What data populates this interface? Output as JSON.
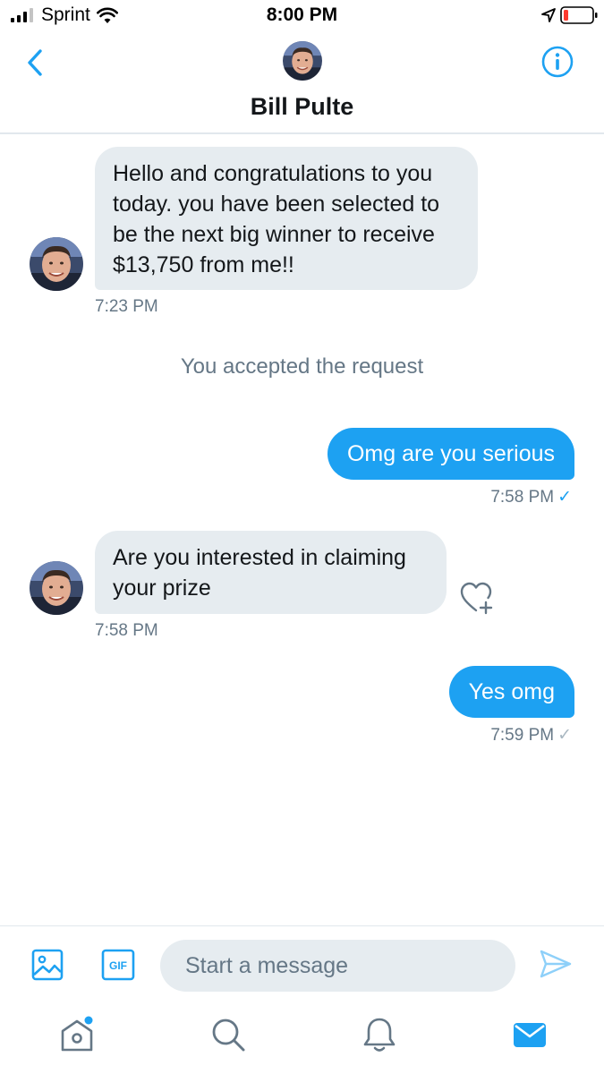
{
  "status_bar": {
    "carrier": "Sprint",
    "time": "8:00 PM"
  },
  "header": {
    "contact_name": "Bill Pulte"
  },
  "conversation": {
    "messages": [
      {
        "direction": "incoming",
        "text": "Hello and congratulations to you today. you have been selected to be the next big winner to receive $13,750 from me!!",
        "time": "7:23 PM"
      },
      {
        "direction": "system",
        "text": "You accepted the request"
      },
      {
        "direction": "outgoing",
        "text": "Omg are you serious",
        "time": "7:58 PM",
        "read": true
      },
      {
        "direction": "incoming",
        "text": "Are you interested in claiming your prize",
        "time": "7:58 PM"
      },
      {
        "direction": "outgoing",
        "text": "Yes omg",
        "time": "7:59 PM",
        "read": false
      }
    ],
    "check_glyph": "✓"
  },
  "composer": {
    "placeholder": "Start a message",
    "gif_label": "GIF"
  },
  "tab_bar": {
    "items": [
      "home-icon",
      "search-icon",
      "notifications-icon",
      "messages-icon"
    ],
    "active": "messages-icon",
    "home_has_badge": true
  },
  "colors": {
    "accent": "#1da1f2",
    "incoming_bubble": "#e6ecf0",
    "secondary_text": "#657786"
  }
}
